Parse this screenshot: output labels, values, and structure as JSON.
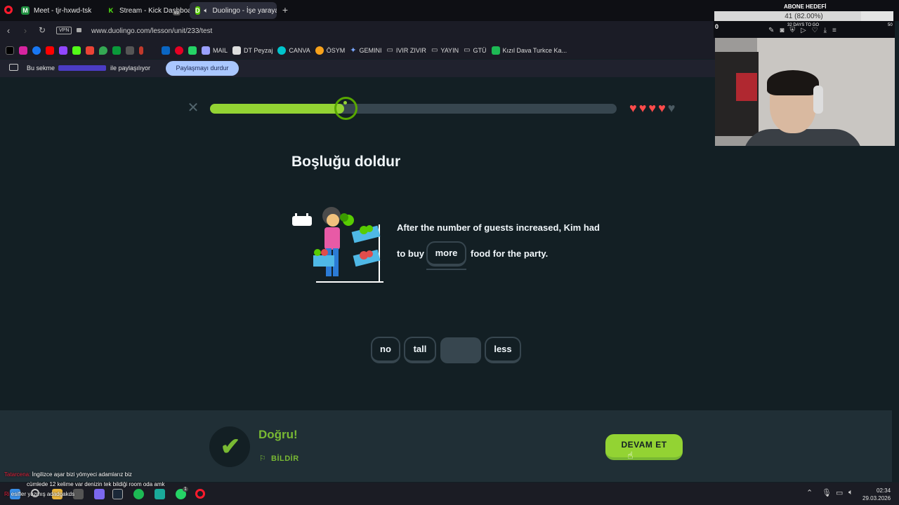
{
  "browser": {
    "tabs": [
      {
        "label": "Meet - tjr-hxwd-tsk",
        "color": "#1e8e3e",
        "glyph": "M"
      },
      {
        "label": "Stream - Kick Dashboard",
        "color": "#53fc18",
        "glyph": "K"
      },
      {
        "label": "Duolingo - İşe yarayan",
        "color": "#58cc02",
        "glyph": "D"
      }
    ],
    "tab_badge": "69",
    "url": "www.duolingo.com/lesson/unit/233/test",
    "vpn_label": "VPN",
    "bookmarks": [
      {
        "label": "MAIL",
        "color": "#9aa0ff"
      },
      {
        "label": "DT Peyzaj",
        "color": "#dddddd"
      },
      {
        "label": "CANVA",
        "color": "#00c4cc"
      },
      {
        "label": "ÖSYM",
        "color": "#f7a21b"
      },
      {
        "label": "GEMINI",
        "color": "#7aa7ff"
      },
      {
        "label": "IVIR ZIVIR",
        "color": "#cccccc"
      },
      {
        "label": "YAYIN",
        "color": "#cccccc"
      },
      {
        "label": "GTÜ",
        "color": "#cccccc"
      },
      {
        "label": "Kızıl Dava Turkce Ka...",
        "color": "#1db954"
      }
    ],
    "share": {
      "prefix": "Bu sekme",
      "suffix": "ile paylaşılıyor",
      "stop_label": "Paylaşmayı durdur"
    }
  },
  "overlay": {
    "goal_title": "ABONE HEDEFİ",
    "goal_progress_text": "41 (82.00%)",
    "goal_fraction": 0.82,
    "goal_start": "0",
    "goal_days": "32 DAYS TO GO",
    "goal_target": "50"
  },
  "lesson": {
    "progress": 0.33,
    "hearts_full": 4,
    "hearts_total": 5,
    "title": "Boşluğu doldur",
    "sentence_line1": "After the number of guests increased, Kim had",
    "sentence_before": "to buy",
    "filled_word": "more",
    "sentence_after": "food for the party.",
    "word_bank": [
      "no",
      "tall",
      "less"
    ]
  },
  "feedback": {
    "status": "Doğru!",
    "report_label": "BİLDİR",
    "continue_label": "DEVAM ET"
  },
  "chat": [
    {
      "user": "Tatarcena:",
      "text": "İngilizce aşar bizi yömyeci adamlarız biz"
    },
    {
      "user": "",
      "text": "cümlede 12 kelime var denizin tek bildiği room oda amk"
    },
    {
      "user": "Ri",
      "text": "esifler yazmış adadgakds"
    }
  ],
  "taskbar": {
    "time": "02:34",
    "date": "29.03.2026",
    "notif": "1"
  },
  "colors": {
    "bg": "#131f24",
    "accent_green": "#93d333",
    "border": "#37464f",
    "heart": "#ff4b4b"
  }
}
